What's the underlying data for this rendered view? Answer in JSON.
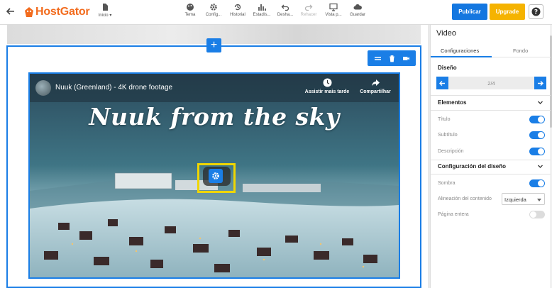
{
  "brand": {
    "name": "HostGator",
    "color": "#f26b1d"
  },
  "toolbar": {
    "items": [
      {
        "label": "Inicio",
        "icon": "page-icon"
      },
      {
        "label": "Tema",
        "icon": "palette-icon"
      },
      {
        "label": "Config...",
        "icon": "gear-icon"
      },
      {
        "label": "Historial",
        "icon": "history-icon"
      },
      {
        "label": "Estadís...",
        "icon": "bar-chart-icon"
      },
      {
        "label": "Desha...",
        "icon": "undo-icon"
      },
      {
        "label": "Rehacer",
        "icon": "redo-icon"
      },
      {
        "label": "Vista p...",
        "icon": "monitor-icon"
      },
      {
        "label": "Guardar",
        "icon": "cloud-icon"
      }
    ],
    "publish_label": "Publicar",
    "upgrade_label": "Upgrade",
    "help_label": "?"
  },
  "colors": {
    "accent": "#1a7ee6",
    "upgrade": "#f5b300",
    "highlight": "#f0d600"
  },
  "video": {
    "title": "Nuuk (Greenland) - 4K drone footage",
    "watch_later": "Assistir mais tarde",
    "share": "Compartilhar",
    "overlay_text": "Nuuk from the sky"
  },
  "panel": {
    "title": "Video",
    "tabs": [
      {
        "label": "Configuraciones",
        "active": true
      },
      {
        "label": "Fondo",
        "active": false
      }
    ],
    "design": {
      "heading": "Diseño",
      "pager": "2/4"
    },
    "elements": {
      "heading": "Elementos",
      "rows": [
        {
          "label": "Título",
          "on": true
        },
        {
          "label": "Subtítulo",
          "on": true
        },
        {
          "label": "Descripción",
          "on": true
        }
      ]
    },
    "layout_config": {
      "heading": "Configuración del diseño",
      "shadow": {
        "label": "Sombra",
        "on": true
      },
      "alignment": {
        "label": "Alineación del contenido",
        "value": "Izquierda"
      },
      "full_page": {
        "label": "Página entera",
        "on": false
      }
    }
  }
}
